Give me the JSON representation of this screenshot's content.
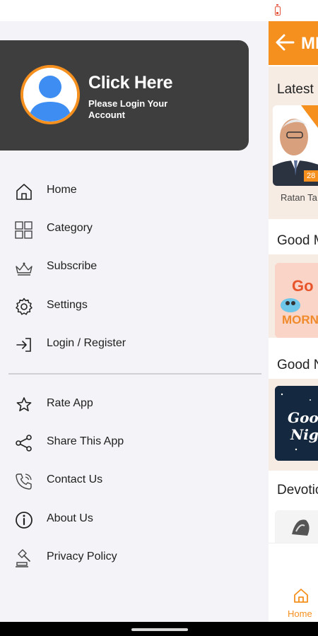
{
  "status_bar": {
    "battery_icon": "battery-low-icon"
  },
  "drawer": {
    "profile": {
      "title": "Click Here",
      "subtitle": "Please Login Your\n Account",
      "avatar_icon": "user-avatar-icon"
    },
    "menu_primary": [
      {
        "label": "Home",
        "icon": "home-icon"
      },
      {
        "label": "Category",
        "icon": "grid-icon"
      },
      {
        "label": "Subscribe",
        "icon": "crown-icon"
      },
      {
        "label": "Settings",
        "icon": "gear-icon"
      },
      {
        "label": "Login / Register",
        "icon": "login-icon"
      }
    ],
    "menu_secondary": [
      {
        "label": "Rate App",
        "icon": "star-icon"
      },
      {
        "label": "Share This App",
        "icon": "share-icon"
      },
      {
        "label": "Contact Us",
        "icon": "phone-icon"
      },
      {
        "label": "About Us",
        "icon": "info-icon"
      },
      {
        "label": "Privacy Policy",
        "icon": "gavel-icon"
      }
    ]
  },
  "app_behind": {
    "header_title": "MI",
    "sections": [
      {
        "title": "Latest"
      },
      {
        "title": "Good M"
      },
      {
        "title": "Good N"
      },
      {
        "title": "Devotio"
      }
    ],
    "latest_card": {
      "badge": "28 D",
      "caption": "Ratan Ta"
    },
    "bottom_nav": {
      "home_label": "Home"
    }
  },
  "colors": {
    "accent": "#f5901e",
    "drawer_bg": "#f4f4f8",
    "profile_bg": "#3e3e3e"
  }
}
